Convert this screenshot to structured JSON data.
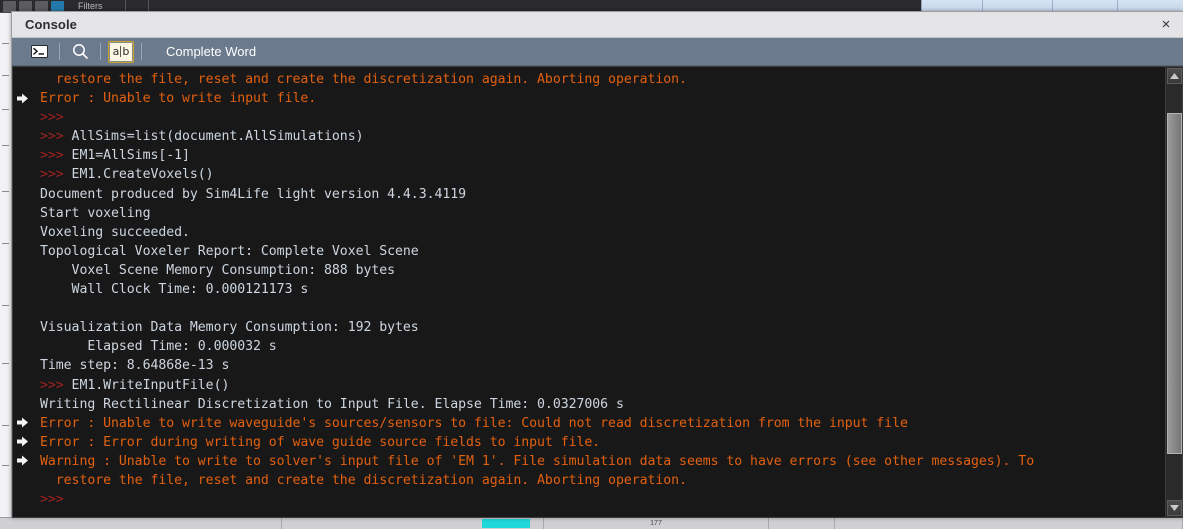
{
  "background_app": {
    "toolbar_label": "Filters",
    "icons": [
      "arrow-icon",
      "sphere-icon",
      "clip-icon",
      "selected-swatch-icon"
    ],
    "status_number": "177"
  },
  "window": {
    "title": "Console",
    "close_label": "×"
  },
  "toolbar": {
    "items": [
      {
        "name": "console-prompt-icon",
        "icon": "terminal-icon",
        "active": false
      },
      {
        "name": "find-icon",
        "icon": "search-icon",
        "active": false
      },
      {
        "name": "complete-word-icon",
        "icon": "ab-icon",
        "active": true
      }
    ],
    "label": "Complete Word",
    "ab_left": "a",
    "ab_right": "b"
  },
  "colors": {
    "console_bg": "#181818",
    "error_text": "#e2600f",
    "plain_text": "#cdd6e0",
    "prompt_text": "#a32121",
    "toolbar_bg": "#6b7a8c",
    "titlebar_bg": "#e4e4e7"
  },
  "console": {
    "lines": [
      {
        "marker": false,
        "type": "error",
        "text": "  restore the file, reset and create the discretization again. Aborting operation."
      },
      {
        "marker": true,
        "type": "error",
        "text": "Error : Unable to write input file."
      },
      {
        "marker": false,
        "type": "prompt",
        "prompt": ">>>",
        "text": ""
      },
      {
        "marker": false,
        "type": "prompt",
        "prompt": ">>>",
        "text": " AllSims=list(document.AllSimulations)"
      },
      {
        "marker": false,
        "type": "prompt",
        "prompt": ">>>",
        "text": " EM1=AllSims[-1]"
      },
      {
        "marker": false,
        "type": "prompt",
        "prompt": ">>>",
        "text": " EM1.CreateVoxels()"
      },
      {
        "marker": false,
        "type": "plain",
        "text": "Document produced by Sim4Life light version 4.4.3.4119"
      },
      {
        "marker": false,
        "type": "plain",
        "text": "Start voxeling"
      },
      {
        "marker": false,
        "type": "plain",
        "text": "Voxeling succeeded."
      },
      {
        "marker": false,
        "type": "plain",
        "text": "Topological Voxeler Report: Complete Voxel Scene"
      },
      {
        "marker": false,
        "type": "plain",
        "text": "    Voxel Scene Memory Consumption: 888 bytes"
      },
      {
        "marker": false,
        "type": "plain",
        "text": "    Wall Clock Time: 0.000121173 s"
      },
      {
        "marker": false,
        "type": "plain",
        "text": ""
      },
      {
        "marker": false,
        "type": "plain",
        "text": "Visualization Data Memory Consumption: 192 bytes"
      },
      {
        "marker": false,
        "type": "plain",
        "text": "      Elapsed Time: 0.000032 s"
      },
      {
        "marker": false,
        "type": "plain",
        "text": "Time step: 8.64868e-13 s"
      },
      {
        "marker": false,
        "type": "prompt",
        "prompt": ">>>",
        "text": " EM1.WriteInputFile()"
      },
      {
        "marker": false,
        "type": "plain",
        "text": "Writing Rectilinear Discretization to Input File. Elapse Time: 0.0327006 s"
      },
      {
        "marker": true,
        "type": "error",
        "text": "Error : Unable to write waveguide's sources/sensors to file: Could not read discretization from the input file"
      },
      {
        "marker": true,
        "type": "error",
        "text": "Error : Error during writing of wave guide source fields to input file."
      },
      {
        "marker": true,
        "type": "error",
        "text": "Warning : Unable to write to solver's input file of 'EM 1'. File simulation data seems to have errors (see other messages). To"
      },
      {
        "marker": false,
        "type": "error",
        "text": "  restore the file, reset and create the discretization again. Aborting operation."
      },
      {
        "marker": false,
        "type": "prompt",
        "prompt": ">>>",
        "text": ""
      }
    ]
  },
  "scrollbar": {
    "up_arrow": "scroll-up-icon",
    "down_arrow": "scroll-down-icon",
    "thumb_top_pct": "7%",
    "thumb_height_pct": "82%"
  }
}
